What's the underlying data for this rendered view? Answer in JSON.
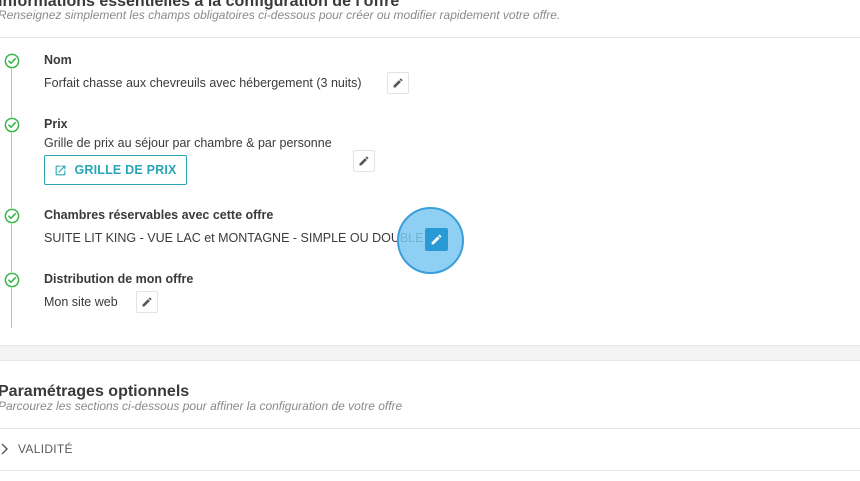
{
  "essentials": {
    "title": "Informations essentielles à la configuration de l'offre",
    "subtitle": "Renseignez simplement les champs obligatoires ci-dessous pour créer ou modifier rapidement votre offre."
  },
  "steps": [
    {
      "label": "Nom",
      "value": "Forfait chasse aux chevreuils avec hébergement (3 nuits)"
    },
    {
      "label": "Prix",
      "value": "Grille de prix au séjour par chambre & par personne",
      "button_label": "GRILLE DE PRIX"
    },
    {
      "label": "Chambres réservables avec cette offre",
      "value": "SUITE LIT KING - VUE LAC et MONTAGNE - SIMPLE OU DOUBLE"
    },
    {
      "label": "Distribution de mon offre",
      "value": "Mon site web"
    }
  ],
  "optional": {
    "title": "Paramétrages optionnels",
    "subtitle": "Parcourez les sections ci-dessous pour affiner la configuration de votre offre",
    "sections": [
      {
        "label": "VALIDITÉ",
        "expanded": false
      }
    ]
  },
  "colors": {
    "accent": "#28a6b6",
    "check": "#3cb54a",
    "active_edit": "#2a9ad6",
    "click_highlight": "#7dc7f2"
  },
  "icons": [
    "check-circle-icon",
    "pencil-icon",
    "external-link-icon",
    "chevron-right-icon"
  ]
}
